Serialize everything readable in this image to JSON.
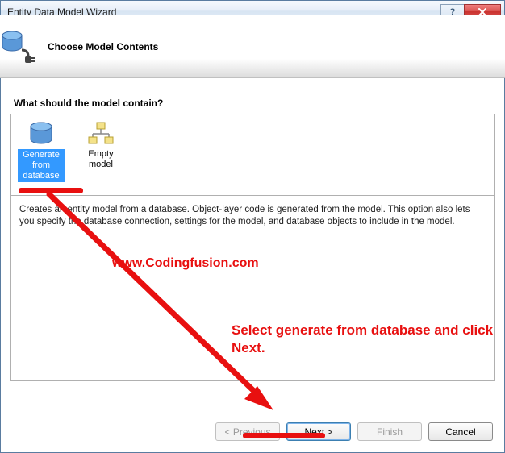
{
  "window": {
    "title": "Entity Data Model Wizard"
  },
  "header": {
    "title": "Choose Model Contents"
  },
  "question": "What should the model contain?",
  "options": {
    "generate": "Generate from database",
    "empty": "Empty model"
  },
  "description": "Creates an entity model from a database. Object-layer code is generated from the model. This option also lets you specify the database connection, settings for the model, and database objects to include in the model.",
  "buttons": {
    "previous": "< Previous",
    "next": "Next >",
    "finish": "Finish",
    "cancel": "Cancel"
  },
  "annotations": {
    "site": "www.Codingfusion.com",
    "instruction": "Select generate from database and click Next."
  }
}
